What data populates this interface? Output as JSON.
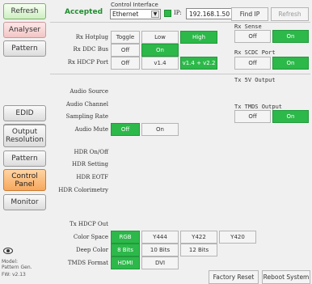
{
  "nav": {
    "refresh": "Refresh",
    "analyser": "Analyser",
    "pattern": "Pattern",
    "edid": "EDID",
    "output_resolution": "Output Resolution",
    "pattern2": "Pattern",
    "control_panel": "Control Panel",
    "monitor": "Monitor"
  },
  "header": {
    "status": "Accepted",
    "control_interface_label": "Control Interface",
    "interface_value": "Ethernet",
    "ip_label": "IP:",
    "ip_value": "192.168.1.50",
    "find_ip": "Find IP",
    "refresh": "Refresh"
  },
  "rx": {
    "hotplug_label": "Rx Hotplug",
    "hotplug_options": [
      "Toggle",
      "Low",
      "High"
    ],
    "ddc_label": "Rx DDC Bus",
    "ddc_options": [
      "Off",
      "On"
    ],
    "hdcp_label": "Rx HDCP Port",
    "hdcp_options": [
      "Off",
      "v1.4",
      "v1.4 + v2.2"
    ],
    "sense_label": "Rx Sense",
    "sense_options": [
      "Off",
      "On"
    ],
    "scdc_label": "Rx SCDC Port",
    "scdc_options": [
      "Off",
      "On"
    ]
  },
  "tx": {
    "tx5v_label": "Tx 5V Output",
    "tmds_label": "Tx TMDS Output",
    "tmds_options": [
      "Off",
      "On"
    ]
  },
  "audio": {
    "source_label": "Audio Source",
    "channel_label": "Audio Channel",
    "rate_label": "Sampling Rate",
    "mute_label": "Audio Mute",
    "mute_options": [
      "Off",
      "On"
    ]
  },
  "hdr": {
    "onoff_label": "HDR On/Off",
    "setting_label": "HDR Setting",
    "eotf_label": "HDR EOTF",
    "colorimetry_label": "HDR Colorimetry"
  },
  "output": {
    "tx_hdcp_label": "Tx HDCP Out",
    "color_space_label": "Color Space",
    "color_space_options": [
      "RGB",
      "Y444",
      "Y422",
      "Y420"
    ],
    "deep_color_label": "Deep Color",
    "deep_color_options": [
      "8 Bits",
      "10 Bits",
      "12 Bits"
    ],
    "tmds_format_label": "TMDS Format",
    "tmds_format_options": [
      "HDMI",
      "DVI"
    ]
  },
  "footer": {
    "model_line1": "Model:",
    "model_line2": "Pattern Gen.",
    "fw": "FW: v2.13",
    "factory_reset": "Factory Reset",
    "reboot": "Reboot System"
  },
  "colors": {
    "on": "#2db84a",
    "accepted": "#1f8f2f",
    "active_nav": "#f6a85e"
  }
}
